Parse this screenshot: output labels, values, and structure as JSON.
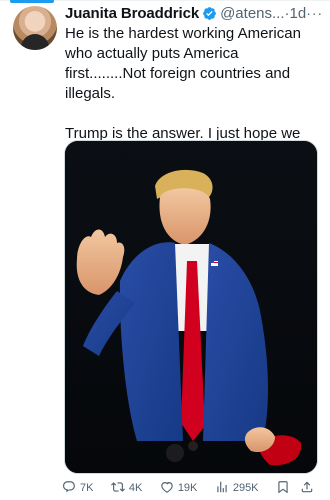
{
  "tweet": {
    "author_name": "Juanita Broaddrick",
    "handle": "@atens...",
    "time": "1d",
    "more_label": "···",
    "text": "He is the hardest working American who actually puts America first........Not foreign countries and illegals.\n\nTrump is the answer.  I just hope we can last until November.",
    "media": {
      "alt": "Photo: man in blue suit with open white shirt raising hand at night"
    }
  },
  "actions": {
    "replies": "7K",
    "reposts": "4K",
    "likes": "19K",
    "views": "295K"
  },
  "colors": {
    "accent": "#1d9bf0",
    "muted": "#536471"
  }
}
